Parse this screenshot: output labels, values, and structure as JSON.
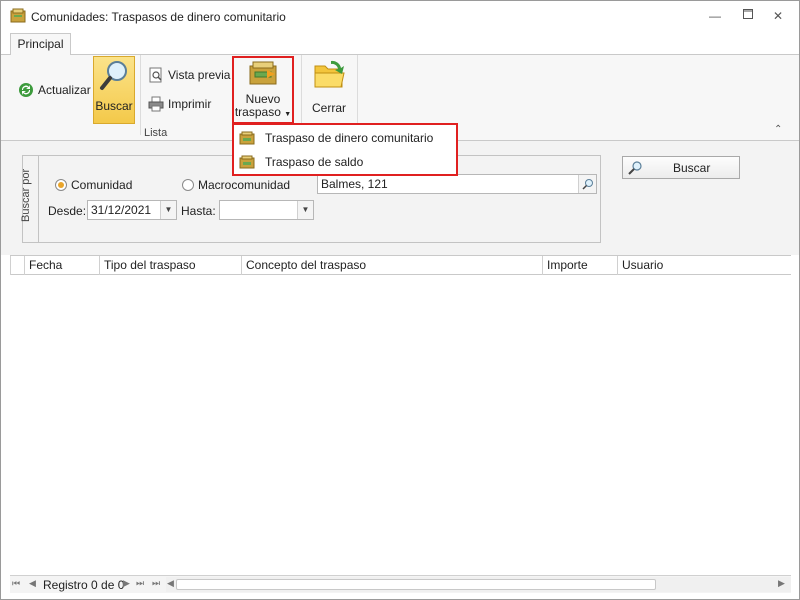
{
  "window": {
    "title": "Comunidades: Traspasos de dinero comunitario"
  },
  "ribbon": {
    "tab": "Principal",
    "group_label": "Lista",
    "actualizar": "Actualizar",
    "buscar": "Buscar",
    "vista_previa": "Vista previa",
    "imprimir": "Imprimir",
    "nuevo_traspaso_line1": "Nuevo",
    "nuevo_traspaso_line2": "traspaso",
    "cerrar": "Cerrar"
  },
  "dropdown": {
    "items": [
      {
        "label": "Traspaso de dinero comunitario"
      },
      {
        "label": "Traspaso de saldo"
      }
    ]
  },
  "search": {
    "group_label": "Buscar por",
    "radio_comunidad": "Comunidad",
    "radio_macrocomunidad": "Macrocomunidad",
    "selected_option": "Comunidad",
    "community_value": "Balmes, 121",
    "desde_label": "Desde:",
    "desde_value": "31/12/2021",
    "hasta_label": "Hasta:",
    "hasta_value": "",
    "button": "Buscar"
  },
  "grid": {
    "columns": [
      "Fecha",
      "Tipo del traspaso",
      "Concepto del traspaso",
      "Importe",
      "Usuario"
    ],
    "rows": []
  },
  "footer": {
    "record_text": "Registro 0 de 0"
  },
  "colors": {
    "highlight": "#e02020",
    "active_button": "#f4c94a",
    "radio_selected": "#e9a52c"
  }
}
